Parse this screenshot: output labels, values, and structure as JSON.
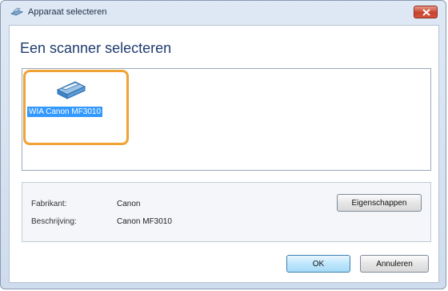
{
  "window": {
    "title": "Apparaat selecteren"
  },
  "dialog": {
    "heading": "Een scanner selecteren"
  },
  "device_list": {
    "items": [
      {
        "label": "WIA Canon MF3010",
        "icon": "scanner-icon",
        "selected": true
      }
    ]
  },
  "details": {
    "manufacturer_label": "Fabrikant:",
    "manufacturer_value": "Canon",
    "description_label": "Beschrijving:",
    "description_value": "Canon MF3010",
    "properties_button": "Eigenschappen"
  },
  "buttons": {
    "ok": "OK",
    "cancel": "Annuleren"
  },
  "colors": {
    "highlight": "#f0a335",
    "selection": "#3399ff",
    "heading": "#1e3c6e"
  }
}
